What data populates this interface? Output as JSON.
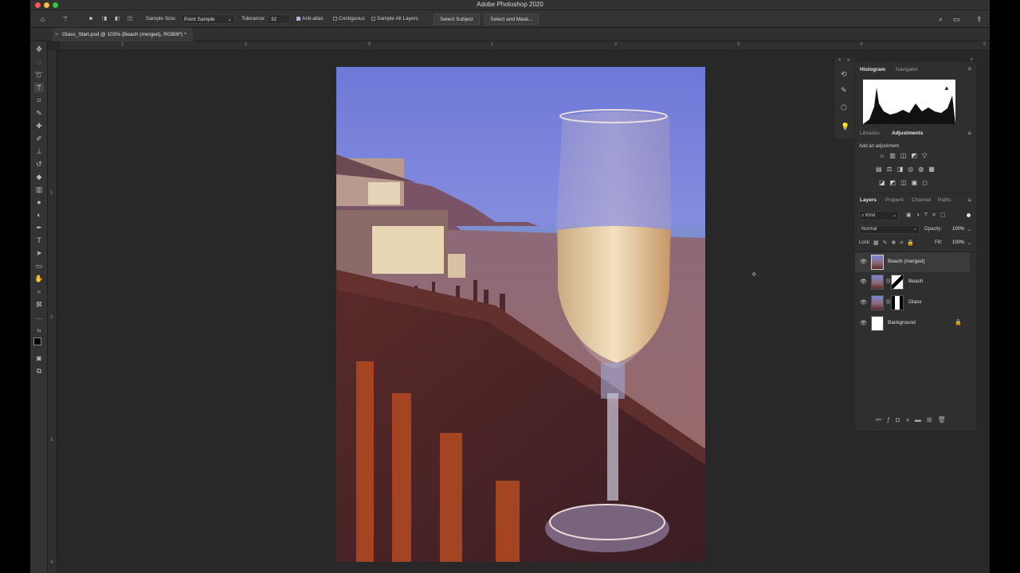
{
  "window": {
    "title": "Adobe Photoshop 2020"
  },
  "options_bar": {
    "sample_size_label": "Sample Size:",
    "sample_size_value": "Point Sample",
    "tolerance_label": "Tolerance:",
    "tolerance_value": "32",
    "anti_alias_label": "Anti-alias",
    "contiguous_label": "Contiguous",
    "sample_all_layers_label": "Sample All Layers",
    "select_subject_label": "Select Subject",
    "select_and_mask_label": "Select and Mask..."
  },
  "document_tab": {
    "label": "Glass_Start.psd @ 103% (Beach (merged), RGB/8*) *"
  },
  "ruler": {
    "top_ticks": [
      "2",
      "1",
      "0",
      "1",
      "2",
      "3",
      "4",
      "5"
    ],
    "left_ticks": [
      "1",
      "2",
      "3",
      "4"
    ]
  },
  "panels": {
    "histogram_tab": "Histogram",
    "navigator_tab": "Navigator",
    "libraries_tab": "Libraries",
    "adjustments_tab": "Adjustments",
    "add_adjustment_label": "Add an adjustment",
    "layers_tab": "Layers",
    "properties_tab": "Properti",
    "channels_tab": "Channel",
    "paths_tab": "Paths",
    "filter_kind": "Kind",
    "blend_mode": "Normal",
    "opacity_label": "Opacity:",
    "opacity_value": "100%",
    "lock_label": "Lock:",
    "fill_label": "Fill:",
    "fill_value": "100%"
  },
  "layers": [
    {
      "name": "Beach (merged)",
      "selected": true
    },
    {
      "name": "Beach",
      "selected": false
    },
    {
      "name": "Glass",
      "selected": false
    },
    {
      "name": "Background",
      "selected": false
    }
  ],
  "colors": {
    "accent": "#aeb8d9",
    "app_bg": "#282828",
    "panel_bg": "#2f2f2f"
  }
}
